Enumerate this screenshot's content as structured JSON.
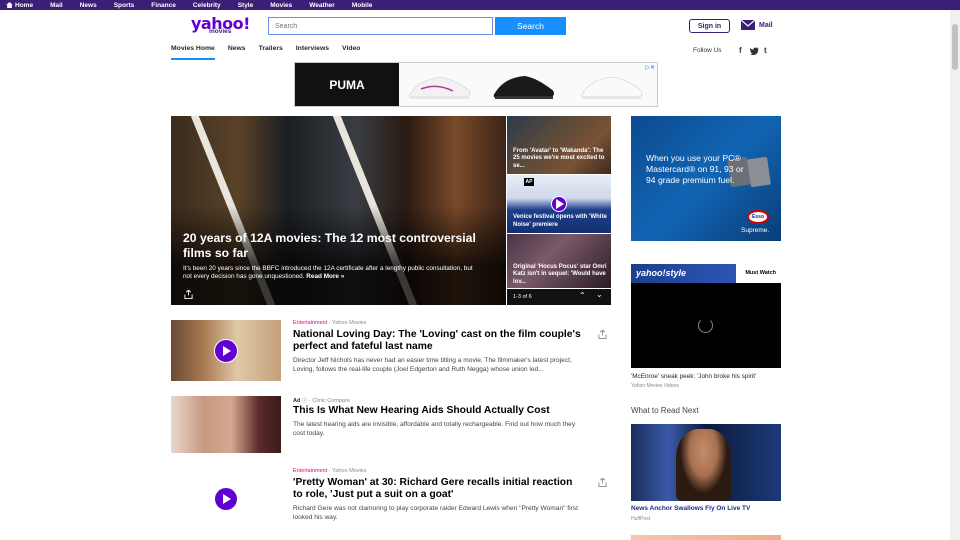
{
  "topbar": {
    "items": [
      "Home",
      "Mail",
      "News",
      "Sports",
      "Finance",
      "Celebrity",
      "Style",
      "Movies",
      "Weather",
      "Mobile"
    ]
  },
  "header": {
    "logo": "yahoo!",
    "logo_sub": "movies",
    "search_placeholder": "Search",
    "search_button": "Search",
    "signin": "Sign in",
    "mail": "Mail"
  },
  "nav": {
    "tabs": [
      "Movies Home",
      "News",
      "Trailers",
      "Interviews",
      "Video"
    ],
    "active": 0,
    "follow": "Follow Us",
    "social": [
      "f",
      "t",
      "t"
    ]
  },
  "ad_banner": {
    "brand": "PUMA"
  },
  "hero": {
    "title": "20 years of 12A movies: The 12 most controversial films so far",
    "desc": "It's been 20 years since the BBFC introduced the 12A certificate after a lengthy public consultation, but not every decision has gone unquestioned.",
    "read_more": "Read More »"
  },
  "side_stories": [
    {
      "caption": "From 'Avatar' to 'Wakanda': The 25 movies we're most excited to se..."
    },
    {
      "caption": "Venice festival opens with 'White Noise' premiere",
      "badge": "AP"
    },
    {
      "caption": "Original 'Hocus Pocus' star Omri Katz isn't in sequel: 'Would have lov..."
    }
  ],
  "pager": {
    "label": "1-3 of 6"
  },
  "right_ad": {
    "text": "When you use your PC® Mastercard® on 91, 93 or 94 grade premium fuel.",
    "brand": "Esso",
    "tagline": "Supreme."
  },
  "style_block": {
    "label": "yahoo!style",
    "must_watch": "Must Watch",
    "caption": "'McEnroe' sneak peek: 'John broke his spirit'",
    "source": "Yahoo Movies Videos"
  },
  "what_to_read": {
    "heading": "What to Read Next",
    "caption": "News Anchor Swallows Fly On Live TV",
    "source": "HuffPost"
  },
  "stories": [
    {
      "category": "Entertainment",
      "source": "Yahoo Movies",
      "title": "National Loving Day: The 'Loving' cast on the film couple's perfect and fateful last name",
      "desc": "Director Jeff Nichols has never had an easier time titling a movie. The filmmaker's latest project, Loving, follows the real-life couple (Joel Edgerton and Ruth Negga) whose union led..."
    },
    {
      "category": "Ad",
      "source": "Clinic Compare",
      "title": "This Is What New Hearing Aids Should Actually Cost",
      "desc": "The latest hearing aids are invisible, affordable and totally rechargeable. Find out how much they cost today."
    },
    {
      "category": "Entertainment",
      "source": "Yahoo Movies",
      "title": "'Pretty Woman' at 30: Richard Gere recalls initial reaction to role, 'Just put a suit on a goat'",
      "desc": "Richard Gere was not clamoring to play corporate raider Edward Lewis when \"Pretty Woman\" first looked his way."
    }
  ],
  "colors": {
    "topbar": "#3c1e76",
    "brand": "#6001d2",
    "search": "#188fff",
    "category": "#e0037f"
  }
}
